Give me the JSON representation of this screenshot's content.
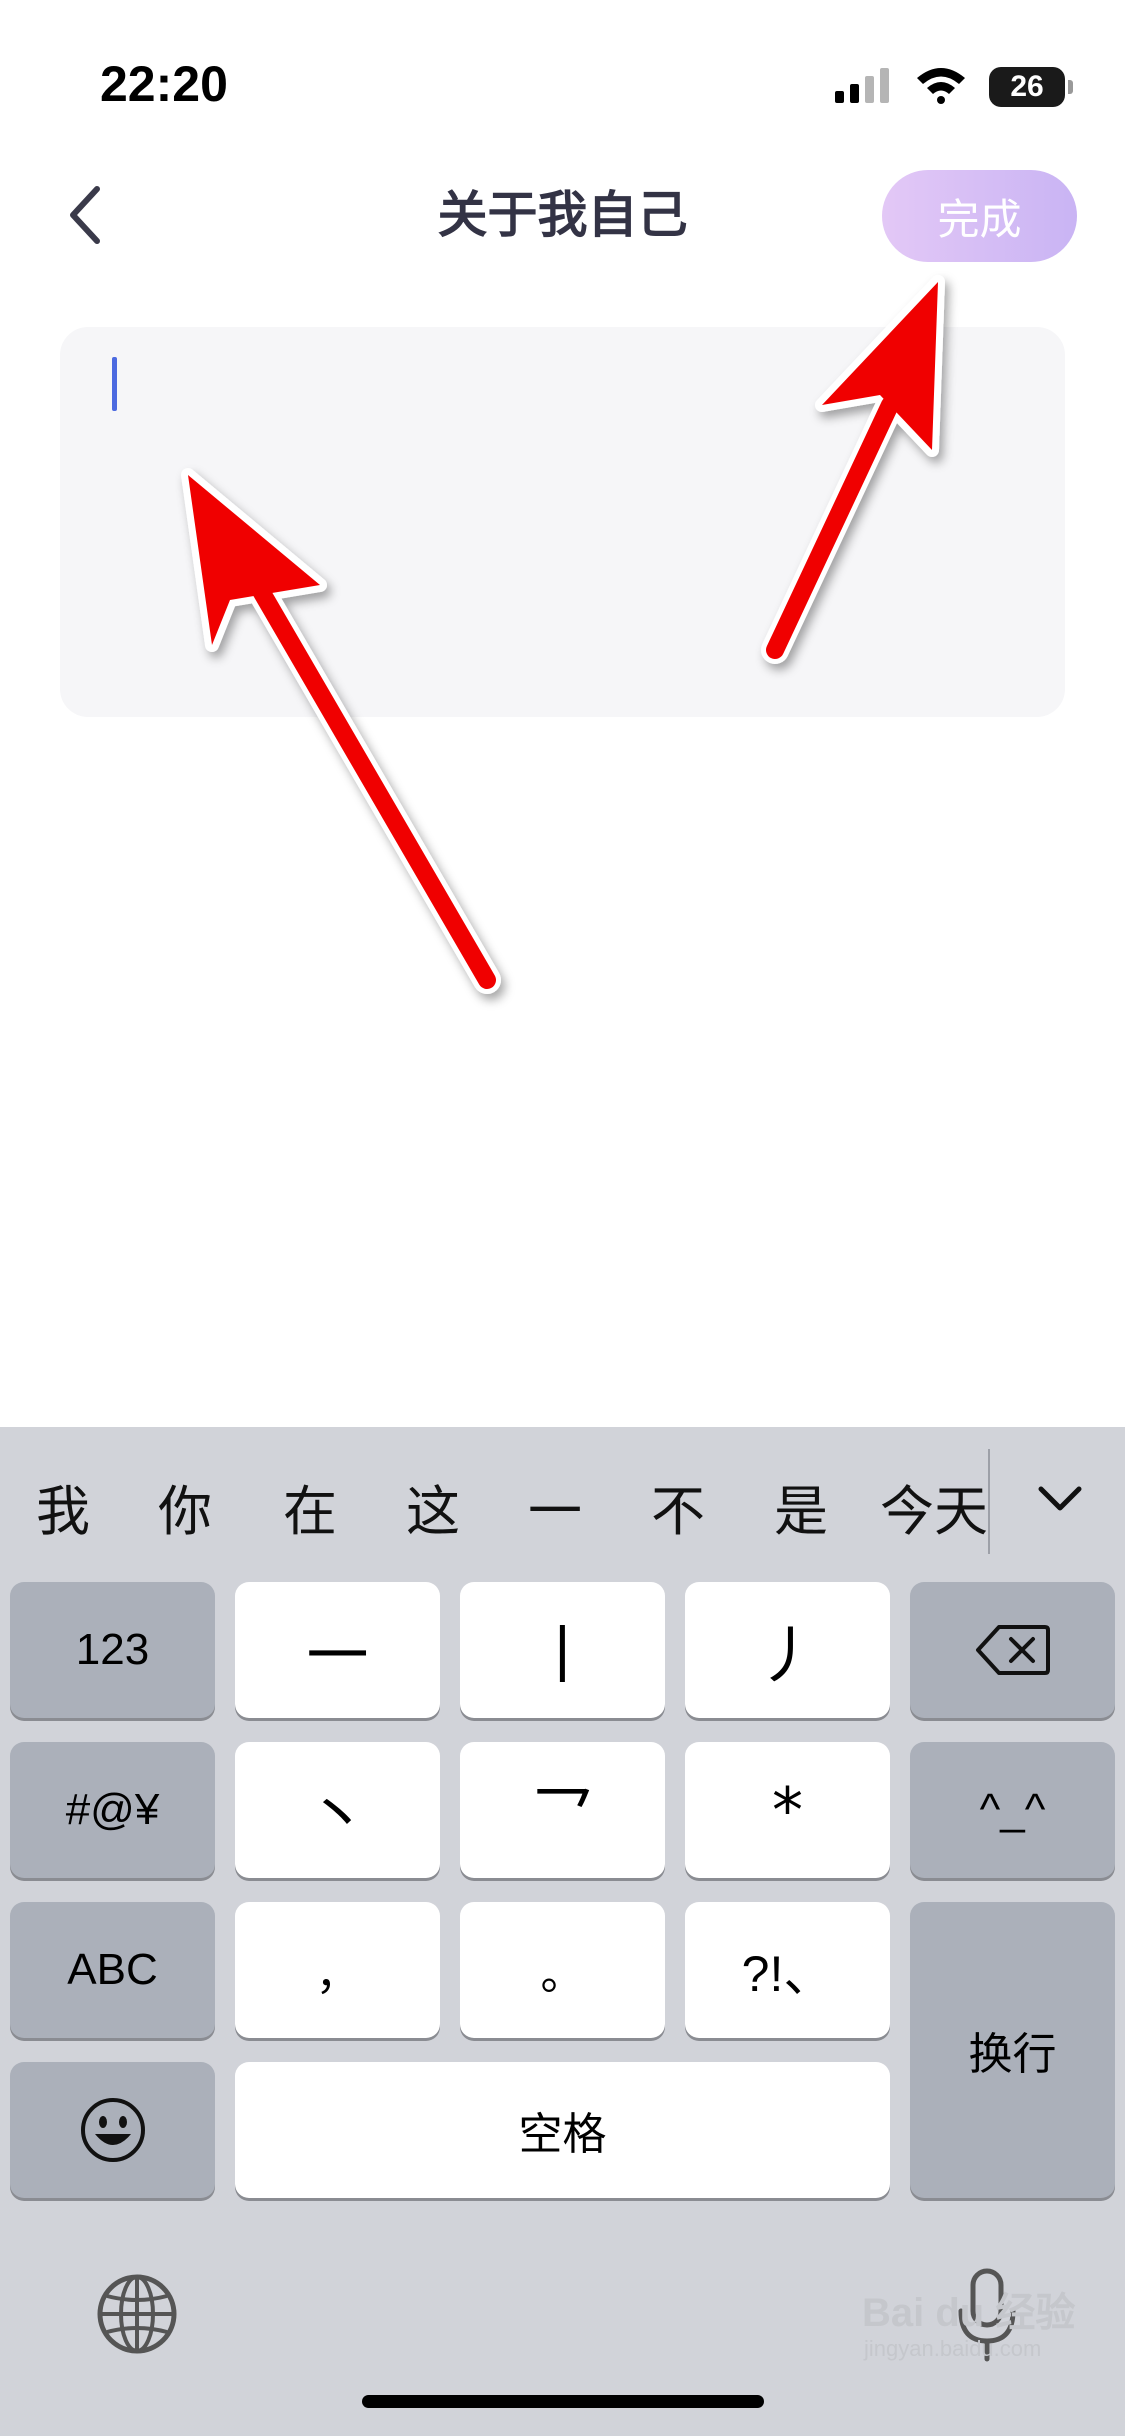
{
  "status_bar": {
    "time": "22:20",
    "battery": "26",
    "icons": [
      "signal-icon",
      "wifi-icon",
      "battery-icon"
    ]
  },
  "header": {
    "back_icon": "chevron-left-icon",
    "title": "关于我自己",
    "done_label": "完成"
  },
  "bio_input": {
    "value": "",
    "placeholder": ""
  },
  "keyboard": {
    "candidates": [
      "我",
      "你",
      "在",
      "这",
      "一",
      "不",
      "是",
      "今天"
    ],
    "expand_icon": "chevron-down-icon",
    "keys": {
      "numbers": "123",
      "symbols": "#@¥",
      "abc": "ABC",
      "stroke_heng": "一",
      "stroke_shu": "丨",
      "stroke_pie": "丿",
      "stroke_dian": "丶",
      "stroke_zhe": "乛",
      "wildcard": "*",
      "comma": "，",
      "period": "。",
      "punct": "?!、",
      "emoticon": "^_^",
      "space": "空格",
      "return": "换行"
    },
    "icons": [
      "backspace-icon",
      "emoji-icon",
      "globe-icon",
      "microphone-icon"
    ]
  },
  "watermark": {
    "text": "Bai du 经验",
    "sub": "jingyan.baidu.com"
  },
  "colors": {
    "done_gradient_start": "#e3c8f6",
    "done_gradient_end": "#c9b4f4",
    "caret": "#4c6ae0",
    "annotation_arrow": "#ff0000",
    "keyboard_bg": "#d1d3d9"
  }
}
